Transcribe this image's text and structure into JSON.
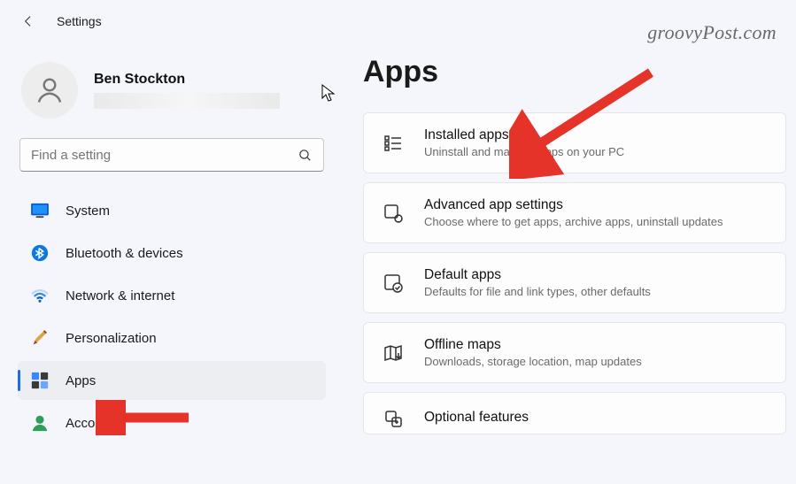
{
  "titlebar": {
    "title": "Settings"
  },
  "watermark": "groovyPost.com",
  "profile": {
    "name": "Ben Stockton"
  },
  "search": {
    "placeholder": "Find a setting"
  },
  "sidebar": {
    "items": [
      {
        "label": "System"
      },
      {
        "label": "Bluetooth & devices"
      },
      {
        "label": "Network & internet"
      },
      {
        "label": "Personalization"
      },
      {
        "label": "Apps"
      },
      {
        "label": "Accounts"
      }
    ]
  },
  "main": {
    "title": "Apps",
    "cards": [
      {
        "title": "Installed apps",
        "sub": "Uninstall and manage apps on your PC"
      },
      {
        "title": "Advanced app settings",
        "sub": "Choose where to get apps, archive apps, uninstall updates"
      },
      {
        "title": "Default apps",
        "sub": "Defaults for file and link types, other defaults"
      },
      {
        "title": "Offline maps",
        "sub": "Downloads, storage location, map updates"
      },
      {
        "title": "Optional features",
        "sub": ""
      }
    ]
  }
}
